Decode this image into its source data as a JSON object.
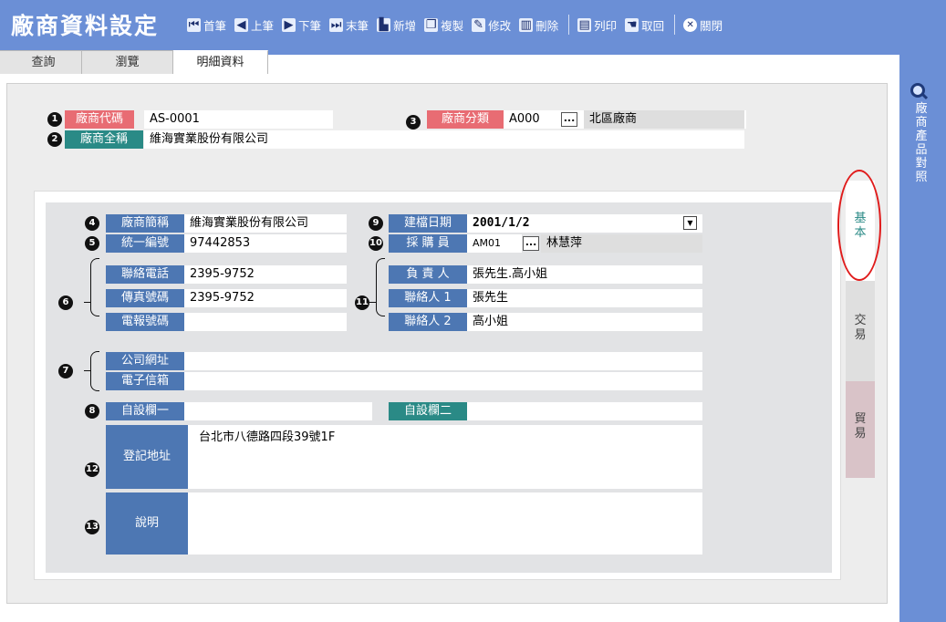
{
  "window": {
    "title": "廠商資料設定"
  },
  "toolbar": [
    {
      "label": "首筆",
      "icon": "first-record-icon",
      "glyph": "⏮"
    },
    {
      "label": "上筆",
      "icon": "previous-record-icon",
      "glyph": "◀"
    },
    {
      "label": "下筆",
      "icon": "next-record-icon",
      "glyph": "▶"
    },
    {
      "label": "末筆",
      "icon": "last-record-icon",
      "glyph": "⏭"
    },
    {
      "label": "新增",
      "icon": "new-document-icon",
      "glyph": "▙"
    },
    {
      "label": "複製",
      "icon": "copy-icon",
      "glyph": "❐"
    },
    {
      "label": "修改",
      "icon": "edit-icon",
      "glyph": "✎"
    },
    {
      "label": "刪除",
      "icon": "trash-icon",
      "glyph": "▥"
    },
    {
      "label": "列印",
      "icon": "printer-icon",
      "glyph": "▤"
    },
    {
      "label": "取回",
      "icon": "hand-icon",
      "glyph": "☚"
    },
    {
      "label": "關閉",
      "icon": "close-icon",
      "glyph": "✕"
    }
  ],
  "tabs": [
    {
      "label": "查詢",
      "active": false
    },
    {
      "label": "瀏覽",
      "active": false
    },
    {
      "label": "明細資料",
      "active": true
    }
  ],
  "header": {
    "vendor_code": {
      "badge": "1",
      "label": "廠商代碼",
      "value": "AS-0001"
    },
    "vendor_fullname": {
      "badge": "2",
      "label": "廠商全稱",
      "value": "維海實業股份有限公司"
    },
    "vendor_category": {
      "badge": "3",
      "label": "廠商分類",
      "code": "A000",
      "lookup": "...",
      "name": "北區廠商"
    }
  },
  "detail": {
    "short_name": {
      "badge": "4",
      "label": "廠商簡稱",
      "value": "維海實業股份有限公司"
    },
    "tax_id": {
      "badge": "5",
      "label": "統一編號",
      "value": "97442853"
    },
    "phones_badge": "6",
    "phone": {
      "label": "聯絡電話",
      "value": "2395-9752"
    },
    "fax": {
      "label": "傳真號碼",
      "value": "2395-9752"
    },
    "telex": {
      "label": "電報號碼",
      "value": ""
    },
    "web_badge": "7",
    "website": {
      "label": "公司網址",
      "value": ""
    },
    "email": {
      "label": "電子信箱",
      "value": ""
    },
    "custom1": {
      "badge": "8",
      "label": "自設欄一",
      "value": ""
    },
    "custom2": {
      "label": "自設欄二",
      "value": ""
    },
    "created_date": {
      "badge": "9",
      "label": "建檔日期",
      "value": "2001/1/2"
    },
    "buyer": {
      "badge": "10",
      "label": "採 購 員",
      "code": "AM01",
      "lookup": "...",
      "name": "林慧萍"
    },
    "contacts_badge": "11",
    "principal": {
      "label": "負 責 人",
      "value": "張先生.高小姐"
    },
    "contact1": {
      "label": "聯絡人 1",
      "value": "張先生"
    },
    "contact2": {
      "label": "聯絡人 2",
      "value": "高小姐"
    },
    "address": {
      "badge": "12",
      "label": "登記地址",
      "value": "台北市八德路四段39號1F"
    },
    "notes": {
      "badge": "13",
      "label": "說明",
      "value": ""
    }
  },
  "side_tabs": [
    {
      "label": "基本",
      "color": "#2a8a86"
    },
    {
      "label": "交易",
      "color": "#444444"
    },
    {
      "label": "貿易",
      "color": "#444444"
    }
  ],
  "side_panel": {
    "label": "廠商產品對照",
    "icon": "search-icon"
  },
  "colors": {
    "title_bar": "#6b8fd6",
    "label_blue": "#4d77b3",
    "label_teal": "#2a8a86",
    "label_pink": "#e86c73",
    "highlight": "#e01b1b"
  }
}
